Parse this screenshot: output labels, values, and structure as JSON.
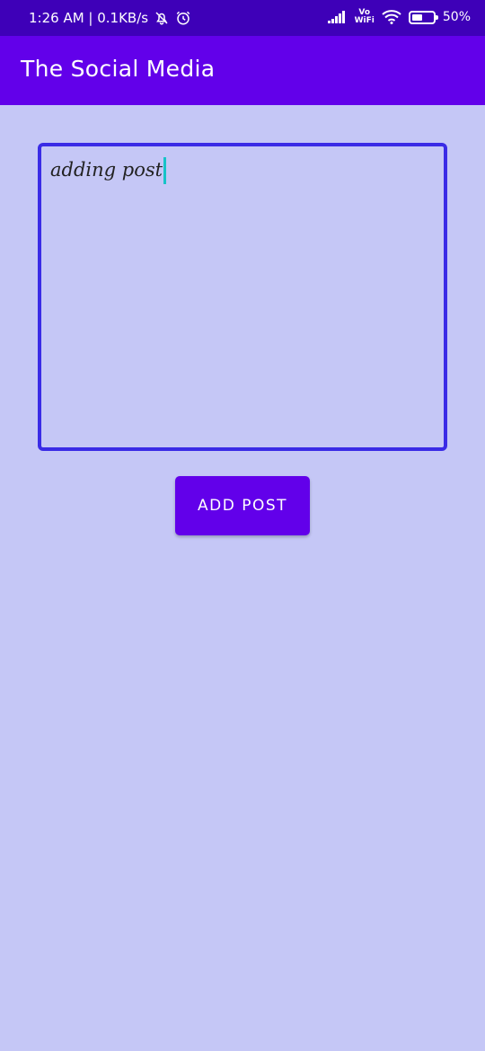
{
  "status_bar": {
    "time_network": "1:26 AM | 0.1KB/s",
    "vo_label": "Vo",
    "wifi_label": "WiFi",
    "battery_percent": "50%",
    "battery_level": 0.5,
    "icons": [
      "mute-bell-icon",
      "alarm-icon",
      "signal-icon",
      "wifi-icon",
      "battery-icon"
    ]
  },
  "app_bar": {
    "title": "The Social Media"
  },
  "post_input": {
    "value": "adding post"
  },
  "add_post_button": {
    "label": "ADD POST"
  },
  "colors": {
    "status_bar": "#3e00b8",
    "app_bar": "#6200ea",
    "background": "#c5c7f6",
    "input_border": "#3a2be6",
    "button": "#6200ea",
    "cursor": "#17c3c8"
  }
}
